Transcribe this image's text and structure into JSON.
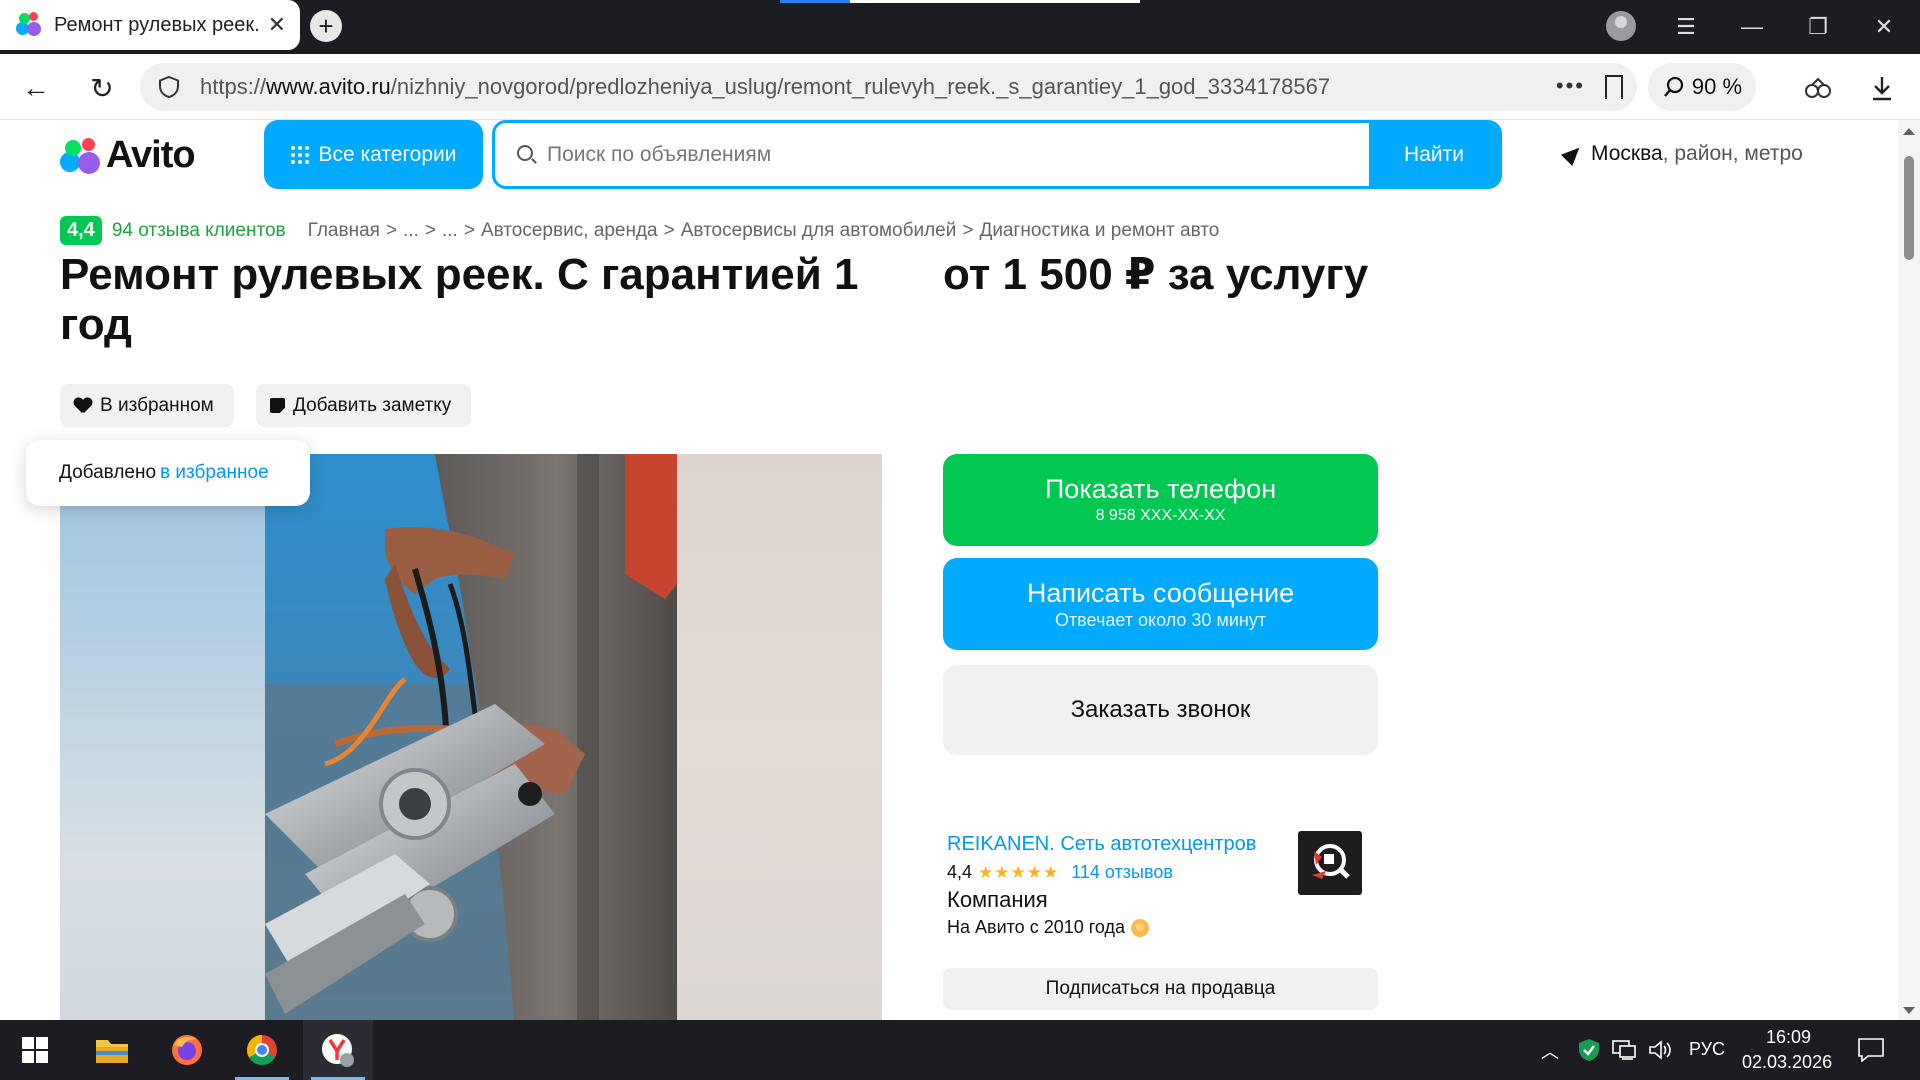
{
  "browser": {
    "tab_title": "Ремонт рулевых реек. С гарантией 1 год",
    "tab_close": "✕",
    "new_tab": "+",
    "url_prefix": "https://",
    "url_host": "www.avito.ru",
    "url_path": "/nizhniy_novgorod/predlozheniya_uslug/remont_rulevyh_reek._s_garantiey_1_god_3334178567",
    "url_more": "•••",
    "zoom": "90 %"
  },
  "header": {
    "logo_text": "Avito",
    "categories_label": "Все категории",
    "search_placeholder": "Поиск по объявлениям",
    "search_button": "Найти",
    "location_city": "Москва",
    "location_rest": ", район, метро"
  },
  "breadcrumbs": {
    "rating": "4,4",
    "reviews": "94 отзыва клиентов",
    "items": [
      "Главная",
      "...",
      "...",
      "Автосервис, аренда",
      "Автосервисы для автомобилей",
      "Диагностика и ремонт авто"
    ],
    "separator": ">"
  },
  "listing": {
    "title": "Ремонт рулевых реек. С гарантией 1 год",
    "price": "от 1 500 ₽ за услугу",
    "favorite_label": "В избранном",
    "note_label": "Добавить заметку",
    "toast_text": "Добавлено",
    "toast_link": "в избранное"
  },
  "actions": {
    "phone_title": "Показать телефон",
    "phone_sub": "8 958 XXX-XX-XX",
    "message_title": "Написать сообщение",
    "message_sub": "Отвечает около 30 минут",
    "callback_title": "Заказать звонок"
  },
  "seller": {
    "name": "REIKANEN. Сеть автотехцентров",
    "rating": "4,4",
    "stars": "★★★★★",
    "reviews": "114 отзывов",
    "type": "Компания",
    "since": "На Авито с 2010 года",
    "subscribe": "Подписаться на продавца"
  },
  "taskbar": {
    "lang": "РУС",
    "time": "16:09",
    "date": "02.03.2026"
  },
  "colors": {
    "avito_blue": "#00aaff",
    "avito_green": "#00c853",
    "link_blue": "#0099ee",
    "star": "#ffb021"
  }
}
